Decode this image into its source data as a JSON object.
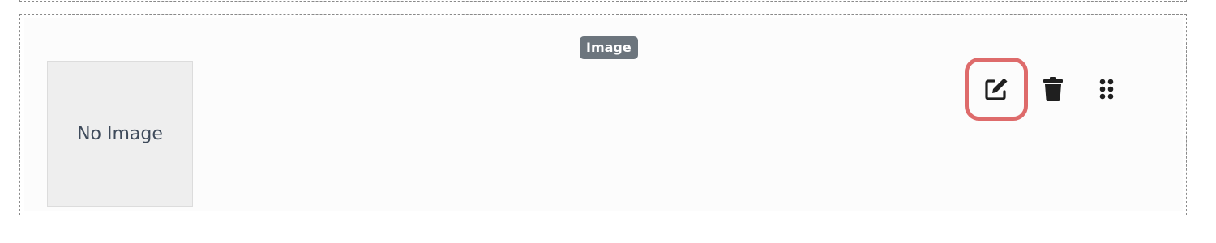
{
  "block": {
    "type_label": "Image",
    "placeholder_text": "No Image"
  },
  "actions": [
    {
      "name": "edit",
      "icon": "edit-icon"
    },
    {
      "name": "delete",
      "icon": "trash-icon"
    },
    {
      "name": "drag",
      "icon": "drag-handle-icon"
    }
  ],
  "colors": {
    "badge_bg": "#6c757d",
    "highlight_border": "#de6b6b",
    "icon": "#1f1f1f",
    "placeholder_bg": "#eeeeee"
  }
}
